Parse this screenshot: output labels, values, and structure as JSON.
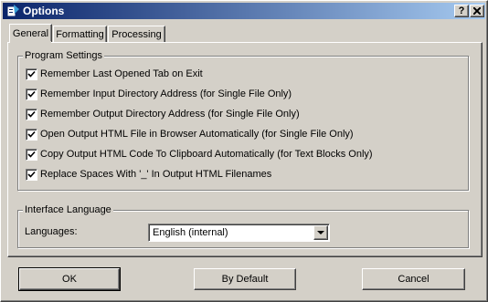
{
  "window": {
    "title": "Options"
  },
  "titlebar_buttons": {
    "help": "?",
    "close": "✕"
  },
  "tabs": [
    {
      "label": "General",
      "active": true
    },
    {
      "label": "Formatting",
      "active": false
    },
    {
      "label": "Processing",
      "active": false
    }
  ],
  "program_settings": {
    "legend": "Program Settings",
    "options": [
      {
        "label": "Remember Last Opened Tab on Exit",
        "checked": true
      },
      {
        "label": "Remember Input Directory Address (for Single File Only)",
        "checked": true
      },
      {
        "label": "Remember Output Directory Address (for Single File Only)",
        "checked": true
      },
      {
        "label": "Open Output HTML File in Browser Automatically (for Single File Only)",
        "checked": true
      },
      {
        "label": "Copy Output HTML Code To Clipboard Automatically (for Text Blocks Only)",
        "checked": true
      },
      {
        "label": "Replace Spaces With '_' In Output HTML Filenames",
        "checked": true
      }
    ]
  },
  "interface_language": {
    "legend": "Interface Language",
    "languages_label": "Languages:",
    "selected_language": "English (internal)"
  },
  "buttons": {
    "ok": "OK",
    "by_default": "By Default",
    "cancel": "Cancel"
  }
}
